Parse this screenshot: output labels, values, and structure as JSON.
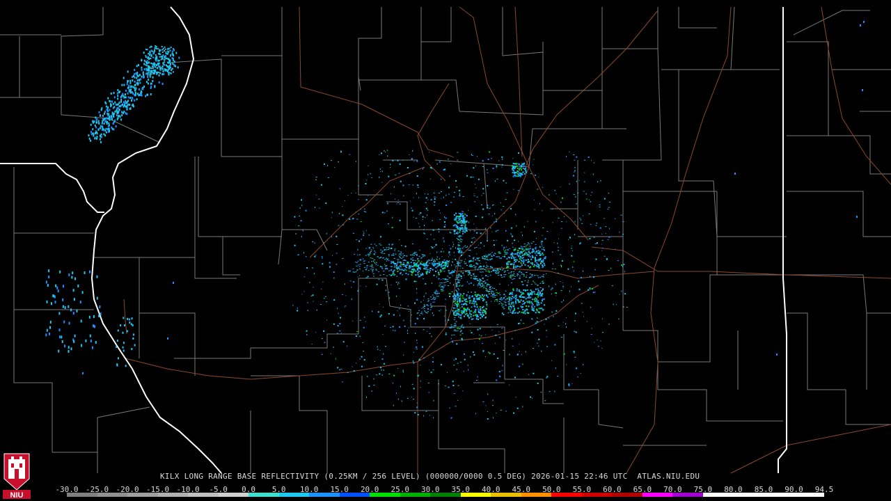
{
  "product": {
    "caption": "KILX LONG RANGE BASE REFLECTIVITY (0.25KM / 256 LEVEL) (000000/0000 0.5 DEG) 2026-01-15 22:46 UTC  ATLAS.NIU.EDU"
  },
  "legend": {
    "labels": [
      "-30.0",
      "-25.0",
      "-20.0",
      "-15.0",
      "-10.0",
      "-5.0",
      "0.0",
      "5.0",
      "10.0",
      "15.0",
      "20.0",
      "25.0",
      "30.0",
      "35.0",
      "40.0",
      "45.0",
      "50.0",
      "55.0",
      "60.0",
      "65.0",
      "70.0",
      "75.0",
      "80.0",
      "85.0",
      "90.0",
      "94.5"
    ],
    "colors": [
      "#808080",
      "#909090",
      "#a0a0a0",
      "#b0b0b0",
      "#c0c0c0",
      "#d0d0d0",
      "#40e0d0",
      "#1ec8f0",
      "#1e90ff",
      "#0050ff",
      "#00e000",
      "#00b000",
      "#008000",
      "#ffff00",
      "#e8c000",
      "#ff9000",
      "#ff0000",
      "#d00000",
      "#b00000",
      "#ff00ff",
      "#a000d0",
      "#ffffff",
      "#ffffff",
      "#ffffff",
      "#ffffff"
    ]
  },
  "logo": {
    "text": "NIU"
  },
  "colors": {
    "background": "#000000",
    "county_lines": "#7a7a7a",
    "state_lines": "#ffffff",
    "highways": "#8b4a2b",
    "echo_primary": "#1ec8f0",
    "echo_secondary": "#1e90ff",
    "echo_strong": "#00e000"
  }
}
